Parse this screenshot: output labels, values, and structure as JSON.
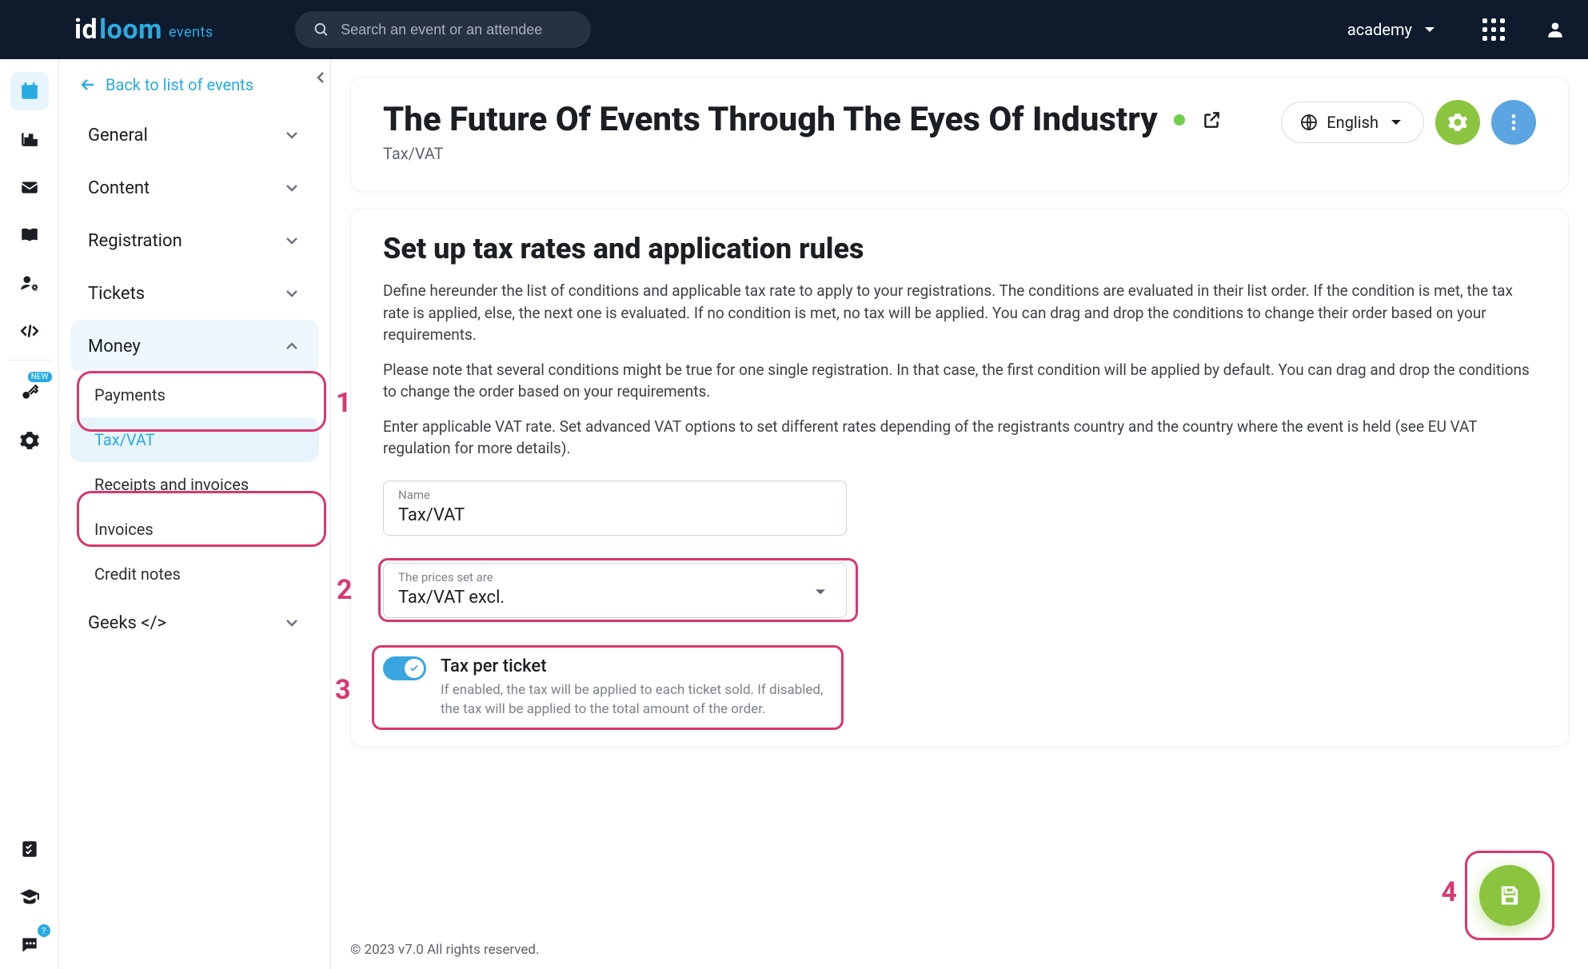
{
  "topbar": {
    "brand_id": "id",
    "brand_loom": "loom",
    "brand_events": "events",
    "search_placeholder": "Search an event or an attendee",
    "account_label": "academy"
  },
  "rail": {
    "items": [
      {
        "name": "calendar",
        "active": true
      },
      {
        "name": "chart"
      },
      {
        "name": "mail"
      },
      {
        "name": "book"
      },
      {
        "name": "user-settings"
      },
      {
        "name": "code"
      }
    ],
    "lower": [
      {
        "name": "key",
        "badge": "NEW"
      },
      {
        "name": "gear"
      }
    ],
    "bottom": [
      {
        "name": "checklist"
      },
      {
        "name": "graduation"
      },
      {
        "name": "chat",
        "badge": "?"
      }
    ]
  },
  "sidebar": {
    "back_label": "Back to list of events",
    "sections": [
      {
        "label": "General",
        "expanded": false
      },
      {
        "label": "Content",
        "expanded": false
      },
      {
        "label": "Registration",
        "expanded": false
      },
      {
        "label": "Tickets",
        "expanded": false
      },
      {
        "label": "Money",
        "expanded": true,
        "children": [
          {
            "label": "Payments"
          },
          {
            "label": "Tax/VAT",
            "active": true
          },
          {
            "label": "Receipts and invoices"
          },
          {
            "label": "Invoices"
          },
          {
            "label": "Credit notes"
          }
        ]
      },
      {
        "label": "Geeks </>",
        "expanded": false
      }
    ]
  },
  "header": {
    "event_title": "The Future Of Events Through The Eyes Of Industry",
    "breadcrumb": "Tax/VAT",
    "language": "English"
  },
  "content": {
    "title": "Set up tax rates and application rules",
    "para1": "Define hereunder the list of conditions and applicable tax rate to apply to your registrations. The conditions are evaluated in their list order. If the condition is met, the tax rate is applied, else, the next one is evaluated. If no condition is met, no tax will be applied. You can drag and drop the conditions to change their order based on your requirements.",
    "para2": "Please note that several conditions might be true for one single registration. In that case, the first condition will be applied by default. You can drag and drop the conditions to change the order based on your requirements.",
    "para3": "Enter applicable VAT rate. Set advanced VAT options to set different rates depending of the registrants country and the country where the event is held (see EU VAT regulation for more details).",
    "name_field": {
      "label": "Name",
      "value": "Tax/VAT"
    },
    "prices_field": {
      "label": "The prices set are",
      "value": "Tax/VAT excl."
    },
    "toggle": {
      "title": "Tax per ticket",
      "desc": "If enabled, the tax will be applied to each ticket sold. If disabled, the tax will be applied to the total amount of the order.",
      "enabled": true
    }
  },
  "annotations": {
    "n1": "1",
    "n2": "2",
    "n3": "3",
    "n4": "4"
  },
  "footer": "© 2023 v7.0 All rights reserved."
}
